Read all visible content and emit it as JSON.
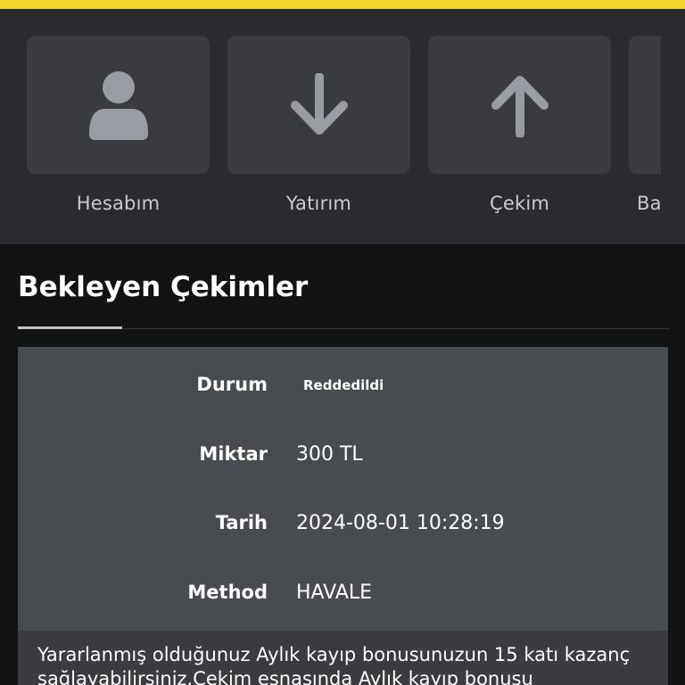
{
  "nav": {
    "tiles": [
      {
        "label": "Hesabım",
        "icon": "user-icon"
      },
      {
        "label": "Yatırım",
        "icon": "arrow-down-icon"
      },
      {
        "label": "Çekim",
        "icon": "arrow-up-icon"
      },
      {
        "label": "Ba",
        "icon": ""
      }
    ]
  },
  "section": {
    "title": "Bekleyen Çekimler"
  },
  "withdrawal": {
    "status_label": "Durum",
    "status_value": "Reddedildi",
    "amount_label": "Miktar",
    "amount_value": "300 TL",
    "date_label": "Tarih",
    "date_value": "2024-08-01 10:28:19",
    "method_label": "Method",
    "method_value": "HAVALE",
    "message": "Yararlanmış olduğunuz Aylık kayıp bonusunuzun 15 katı kazanç sağlayabilirsiniz.Çekim esnasında Aylık kayıp bonusu"
  },
  "colors": {
    "accent": "#f6d32b",
    "background": "#121315",
    "nav_bg": "#2a2b2e",
    "tile_bg": "#3a3b3f",
    "card_bg": "#484b50",
    "icon": "#9a9ca3"
  }
}
